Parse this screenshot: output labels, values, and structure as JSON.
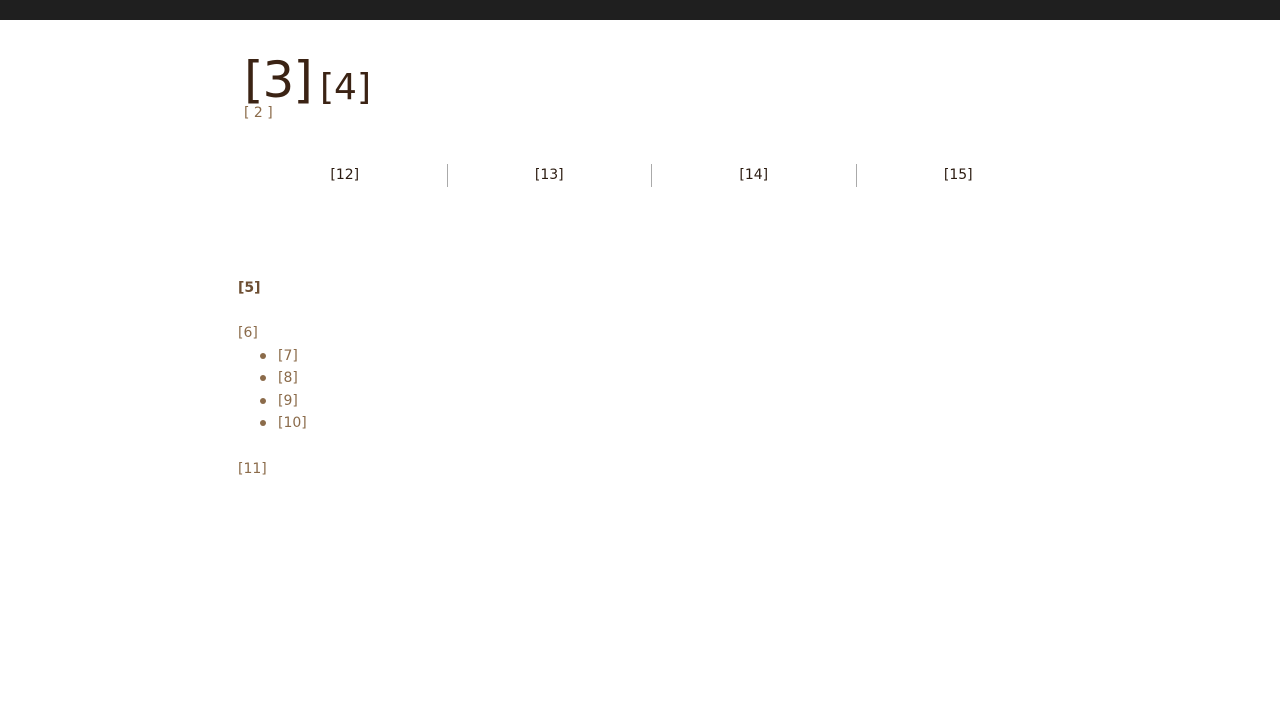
{
  "header": {
    "logo_big": "[3]",
    "logo_small": "[4]",
    "tagline": "[ 2 ]"
  },
  "nav": {
    "items": [
      {
        "label": "[12]"
      },
      {
        "label": "[13]"
      },
      {
        "label": "[14]"
      },
      {
        "label": "[15]"
      }
    ]
  },
  "content": {
    "heading": "[5]",
    "intro": "[6]",
    "bullets": [
      "[7]",
      "[8]",
      "[9]",
      "[10]"
    ],
    "footer_link": "[11]"
  },
  "colors": {
    "topbar": "#1f1f1f",
    "logo": "#3b2314",
    "accent_text": "#8b6b4a",
    "nav_text": "#2b1b10"
  }
}
